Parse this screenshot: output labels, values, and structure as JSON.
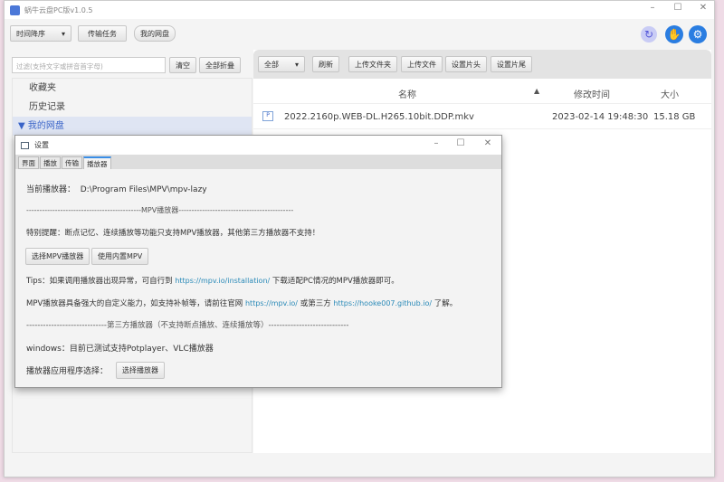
{
  "app": {
    "title": "蜗牛云盘PC版v1.0.5",
    "minimize": "–",
    "maximize": "☐",
    "close": "✕"
  },
  "toolbar": {
    "sort": "时间降序",
    "transfer": "传输任务",
    "mydisk": "我的网盘"
  },
  "icons": {
    "refresh": "↻",
    "like": "👍",
    "settings": "⚙"
  },
  "left": {
    "filter_placeholder": "过滤(支持文字或拼音首字母)",
    "clear": "清空",
    "collapse_all": "全部折叠",
    "tree": [
      {
        "label": "收藏夹"
      },
      {
        "label": "历史记录"
      },
      {
        "label": "我的网盘",
        "arrow": "▼"
      }
    ]
  },
  "right": {
    "filter": "全部",
    "buttons": [
      "刷新",
      "上传文件夹",
      "上传文件",
      "设置片头",
      "设置片尾"
    ],
    "columns": {
      "name": "名称",
      "sort_arrow": "▲",
      "modified": "修改时间",
      "size": "大小"
    },
    "files": [
      {
        "name": "2022.2160p.WEB-DL.H265.10bit.DDP.mkv",
        "modified": "2023-02-14 19:48:30",
        "size": "15.18 GB"
      }
    ]
  },
  "dialog": {
    "title": "设置",
    "tabs": [
      "界面",
      "播放",
      "传输",
      "播放器"
    ],
    "active_tab": 3,
    "current_label": "当前播放器：",
    "current_value": "D:\\Program Files\\MPV\\mpv-lazy",
    "mpv_divider": "--------------------------------------------MPV播放器--------------------------------------------",
    "notice": "特别提醒：断点记忆、连续播放等功能只支持MPV播放器，其他第三方播放器不支持！",
    "choose_mpv": "选择MPV播放器",
    "use_builtin": "使用内置MPV",
    "tips_pre": "Tips：如果调用播放器出现异常，可自行到",
    "tips_link": "https://mpv.io/installation/",
    "tips_post": "下载适配PC情况的MPV播放器即可。",
    "mpv_pre": "MPV播放器具备强大的自定义能力，如支持补帧等，请前往官网",
    "mpv_link1": "https://mpv.io/",
    "mpv_mid": "或第三方",
    "mpv_link2": "https://hooke007.github.io/",
    "mpv_post": "了解。",
    "third_divider": "-----------------------------第三方播放器（不支持断点播放、连续播放等）-----------------------------",
    "windows": "windows：目前已测试支持Potplayer、VLC播放器",
    "app_label": "播放器应用程序选择：",
    "choose_player": "选择播放器"
  }
}
